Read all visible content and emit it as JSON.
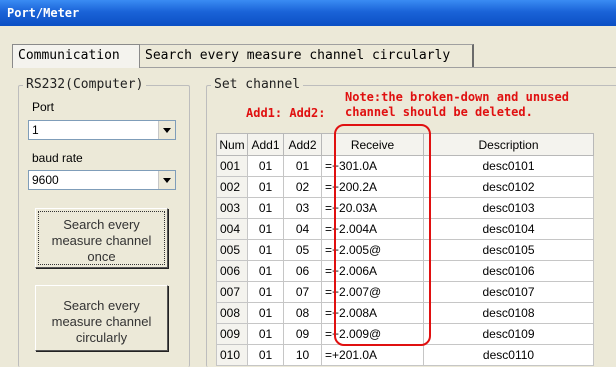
{
  "window": {
    "title": "Port/Meter"
  },
  "tabs": [
    {
      "label": "Communication",
      "active": true
    },
    {
      "label": "Search every measure channel circularly",
      "active": false
    }
  ],
  "rs232": {
    "legend": "RS232(Computer)",
    "port_label": "Port",
    "port_value": "1",
    "baud_label": "baud rate",
    "baud_value": "9600",
    "search_once_button": [
      "Search every",
      "measure channel",
      "once"
    ],
    "search_circular_button": [
      "Search every",
      "measure channel",
      "circularly"
    ]
  },
  "set_channel": {
    "legend": "Set channel",
    "add_headers": "Add1: Add2:",
    "note": "Note:the broken-down and unused\nchannel should be deleted.",
    "columns": [
      "Num",
      "Add1",
      "Add2",
      "Receive",
      "Description"
    ],
    "rows": [
      [
        "001",
        "01",
        "01",
        "=+301.0A",
        "desc0101"
      ],
      [
        "002",
        "01",
        "02",
        "=+200.2A",
        "desc0102"
      ],
      [
        "003",
        "01",
        "03",
        "=+20.03A",
        "desc0103"
      ],
      [
        "004",
        "01",
        "04",
        "=+2.004A",
        "desc0104"
      ],
      [
        "005",
        "01",
        "05",
        "=+2.005@",
        "desc0105"
      ],
      [
        "006",
        "01",
        "06",
        "=+2.006A",
        "desc0106"
      ],
      [
        "007",
        "01",
        "07",
        "=+2.007@",
        "desc0107"
      ],
      [
        "008",
        "01",
        "08",
        "=+2.008A",
        "desc0108"
      ],
      [
        "009",
        "01",
        "09",
        "=+2.009@",
        "desc0109"
      ],
      [
        "010",
        "01",
        "10",
        "=+201.0A",
        "desc0110"
      ]
    ]
  },
  "colors": {
    "accent_red": "#e01010",
    "titlebar_blue": "#1a63d8"
  },
  "icons": {
    "combo_arrow": "chevron-down-icon"
  }
}
